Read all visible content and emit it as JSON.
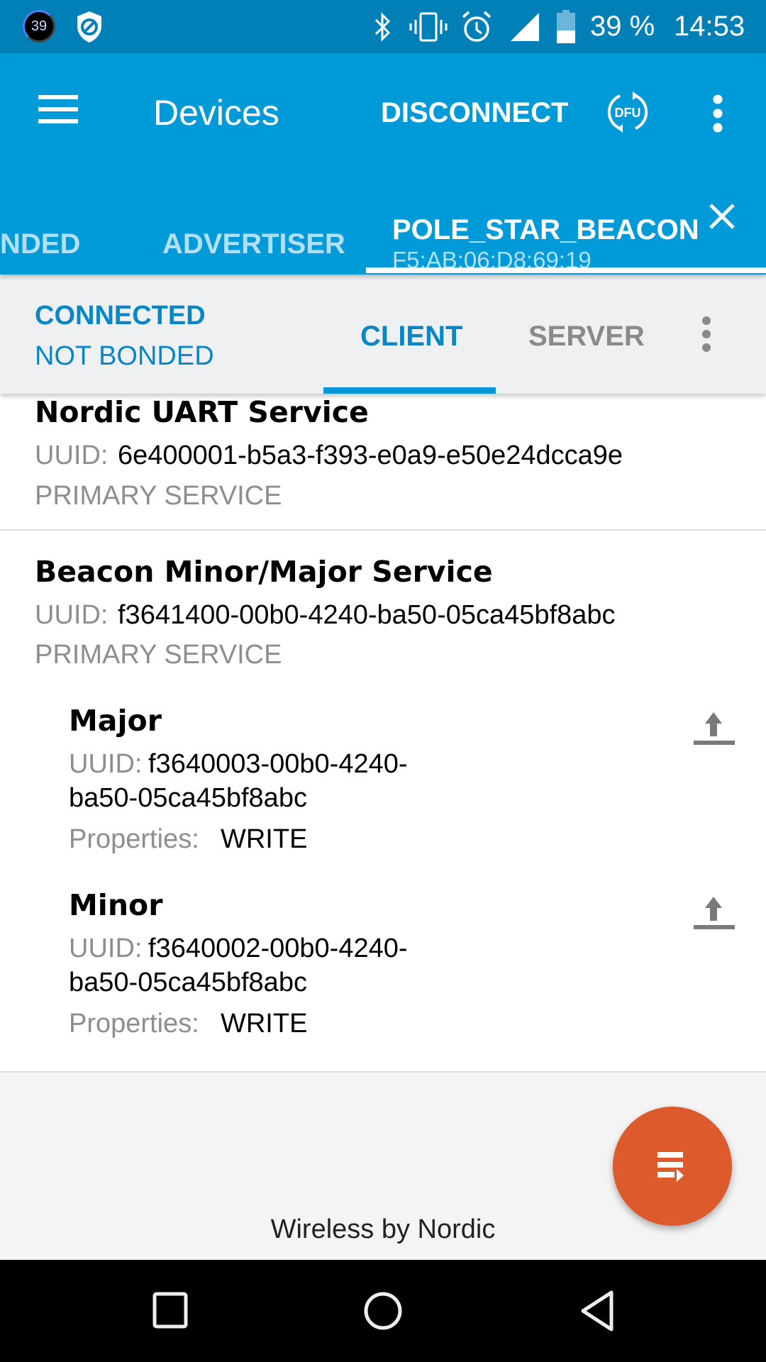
{
  "status_bar": {
    "notification_badge": "39",
    "battery_percent": "39 %",
    "time": "14:53",
    "icons": [
      "badge-icon",
      "shield-block-icon",
      "bluetooth-icon",
      "vibrate-icon",
      "alarm-icon",
      "signal-icon",
      "battery-icon"
    ]
  },
  "toolbar": {
    "menu_icon": "hamburger-menu-icon",
    "title": "Devices",
    "disconnect_label": "DISCONNECT",
    "dfu_label": "DFU",
    "overflow_icon": "more-vert-icon"
  },
  "device_tabs": [
    {
      "label": "NDED"
    },
    {
      "label": "ADVERTISER"
    },
    {
      "label": "POLE_STAR_BEACON",
      "sublabel": "F5:AB:06:D8:69:19",
      "selected": true
    }
  ],
  "connection": {
    "status": "CONNECTED",
    "bond": "NOT BONDED",
    "tabs": [
      {
        "label": "CLIENT",
        "selected": true
      },
      {
        "label": "SERVER",
        "selected": false
      }
    ]
  },
  "services": [
    {
      "name": "Nordic UART Service",
      "uuid_label": "UUID:",
      "uuid": "6e400001-b5a3-f393-e0a9-e50e24dcca9e",
      "type": "PRIMARY SERVICE"
    },
    {
      "name": "Beacon Minor/Major Service",
      "uuid_label": "UUID:",
      "uuid": "f3641400-00b0-4240-ba50-05ca45bf8abc",
      "type": "PRIMARY SERVICE",
      "characteristics": [
        {
          "name": "Major",
          "uuid_label": "UUID:",
          "uuid_line1": "f3640003-00b0-4240-",
          "uuid_line2": "ba50-05ca45bf8abc",
          "properties_label": "Properties:",
          "properties": "WRITE"
        },
        {
          "name": "Minor",
          "uuid_label": "UUID:",
          "uuid_line1": "f3640002-00b0-4240-",
          "uuid_line2": "ba50-05ca45bf8abc",
          "properties_label": "Properties:",
          "properties": "WRITE"
        }
      ]
    }
  ],
  "footer": {
    "brand": "Wireless by Nordic"
  },
  "colors": {
    "status_bar": "#0180b8",
    "app_bar": "#009ad9",
    "accent_blue": "#0a86c4",
    "fab": "#dd5a2c"
  }
}
